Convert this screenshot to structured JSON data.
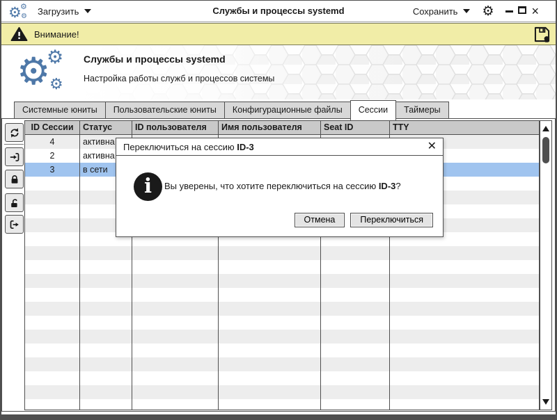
{
  "titlebar": {
    "load_menu": "Загрузить",
    "title": "Службы и процессы systemd",
    "save_menu": "Сохранить"
  },
  "warning_bar": {
    "label": "Внимание!"
  },
  "header": {
    "title": "Службы и процессы systemd",
    "subtitle": "Настройка работы служб и процессов системы"
  },
  "tabs": [
    {
      "name": "tab-system-units",
      "label": "Системные юниты",
      "active": false
    },
    {
      "name": "tab-user-units",
      "label": "Пользовательские юниты",
      "active": false
    },
    {
      "name": "tab-config-files",
      "label": "Конфигурационные файлы",
      "active": false
    },
    {
      "name": "tab-sessions",
      "label": "Сессии",
      "active": true
    },
    {
      "name": "tab-timers",
      "label": "Таймеры",
      "active": false
    }
  ],
  "sidebar": {
    "buttons": [
      {
        "name": "refresh-button",
        "icon": "refresh-arrows-icon"
      },
      {
        "name": "switch-session-button",
        "icon": "enter-arrow-icon"
      },
      {
        "name": "lock-session-button",
        "icon": "padlock-closed-icon"
      },
      {
        "name": "unlock-session-button",
        "icon": "padlock-open-icon"
      },
      {
        "name": "terminate-session-button",
        "icon": "exit-arrow-icon"
      }
    ]
  },
  "table": {
    "columns": [
      "ID Сессии",
      "Статус",
      "ID пользователя",
      "Имя пользователя",
      "Seat ID",
      "TTY"
    ],
    "rows": [
      {
        "id": "4",
        "status": "активна",
        "selected": false
      },
      {
        "id": "2",
        "status": "активна",
        "selected": false
      },
      {
        "id": "3",
        "status": "в сети",
        "selected": true
      }
    ],
    "filler_row_count": 20
  },
  "dialog": {
    "title_prefix": "Переключиться на сессию ",
    "session_id": "ID-3",
    "message_prefix": "Вы уверены, что хотите переключиться на сессию ",
    "message_suffix": "?",
    "close_glyph": "✕",
    "cancel_label": "Отмена",
    "confirm_label": "Переключиться"
  },
  "icons": {
    "app_logo": "blue-gears",
    "settings": "gear",
    "warning": "warning-triangle",
    "save_file": "floppy-with-lock",
    "info": "info-circle",
    "window_controls": [
      "minimize",
      "maximize",
      "close"
    ]
  },
  "colors": {
    "accent_blue": "#4e78a8",
    "warning_bg": "#f1eda7",
    "selected_row": "#a0c4ef",
    "header_row_bg": "#c9c9c9",
    "stripe_bg": "#ededed",
    "frame": "#4f4f4f"
  }
}
